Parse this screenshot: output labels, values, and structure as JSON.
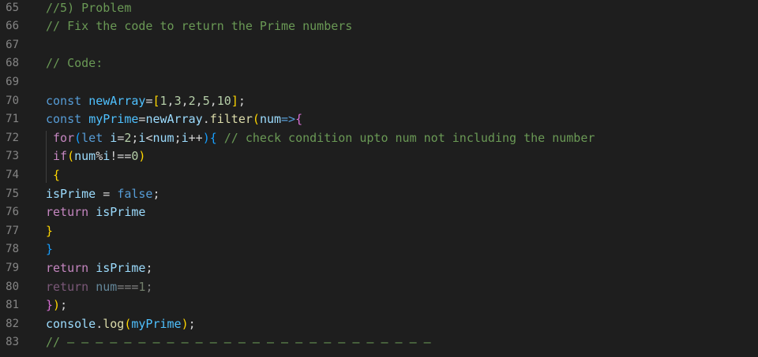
{
  "editor": {
    "colors": {
      "background": "#1e1e1e",
      "line_number": "#858585",
      "comment": "#6a9955",
      "keyword": "#569cd6",
      "control": "#c586c0",
      "variable": "#9cdcfe",
      "constant": "#4fc1ff",
      "function": "#dcdcaa",
      "number": "#b5cea8",
      "plain": "#d4d4d4",
      "bracket1": "#ffd700",
      "bracket2": "#da70d6",
      "bracket3": "#179fff"
    },
    "lines": [
      {
        "number": "65",
        "tokens": [
          {
            "text": "//5) Problem",
            "type": "comment"
          }
        ]
      },
      {
        "number": "66",
        "tokens": [
          {
            "text": "// Fix the code to return the Prime numbers",
            "type": "comment"
          }
        ]
      },
      {
        "number": "67",
        "tokens": []
      },
      {
        "number": "68",
        "tokens": [
          {
            "text": "// Code:",
            "type": "comment"
          }
        ]
      },
      {
        "number": "69",
        "tokens": []
      },
      {
        "number": "70",
        "tokens": [
          {
            "text": "const",
            "type": "keyword"
          },
          {
            "text": " ",
            "type": "plain"
          },
          {
            "text": "newArray",
            "type": "constant"
          },
          {
            "text": "=",
            "type": "plain"
          },
          {
            "text": "[",
            "type": "bracket1"
          },
          {
            "text": "1",
            "type": "num"
          },
          {
            "text": ",",
            "type": "plain"
          },
          {
            "text": "3",
            "type": "num"
          },
          {
            "text": ",",
            "type": "plain"
          },
          {
            "text": "2",
            "type": "num"
          },
          {
            "text": ",",
            "type": "plain"
          },
          {
            "text": "5",
            "type": "num"
          },
          {
            "text": ",",
            "type": "plain"
          },
          {
            "text": "10",
            "type": "num"
          },
          {
            "text": "]",
            "type": "bracket1"
          },
          {
            "text": ";",
            "type": "plain"
          }
        ]
      },
      {
        "number": "71",
        "tokens": [
          {
            "text": "const",
            "type": "keyword"
          },
          {
            "text": " ",
            "type": "plain"
          },
          {
            "text": "myPrime",
            "type": "constant"
          },
          {
            "text": "=",
            "type": "plain"
          },
          {
            "text": "newArray",
            "type": "var"
          },
          {
            "text": ".",
            "type": "plain"
          },
          {
            "text": "filter",
            "type": "func"
          },
          {
            "text": "(",
            "type": "bracket1"
          },
          {
            "text": "num",
            "type": "var"
          },
          {
            "text": "=>",
            "type": "keyword"
          },
          {
            "text": "{",
            "type": "bracket2"
          }
        ]
      },
      {
        "number": "72",
        "tokens": [
          {
            "text": " ",
            "type": "plain"
          },
          {
            "text": "for",
            "type": "control"
          },
          {
            "text": "(",
            "type": "bracket3"
          },
          {
            "text": "let",
            "type": "keyword"
          },
          {
            "text": " ",
            "type": "plain"
          },
          {
            "text": "i",
            "type": "var"
          },
          {
            "text": "=",
            "type": "plain"
          },
          {
            "text": "2",
            "type": "num"
          },
          {
            "text": ";",
            "type": "plain"
          },
          {
            "text": "i",
            "type": "var"
          },
          {
            "text": "<",
            "type": "plain"
          },
          {
            "text": "num",
            "type": "var"
          },
          {
            "text": ";",
            "type": "plain"
          },
          {
            "text": "i",
            "type": "var"
          },
          {
            "text": "++",
            "type": "plain"
          },
          {
            "text": ")",
            "type": "bracket3"
          },
          {
            "text": "{",
            "type": "bracket3"
          },
          {
            "text": " ",
            "type": "plain"
          },
          {
            "text": "// check condition upto num not including the number",
            "type": "comment"
          }
        ]
      },
      {
        "number": "73",
        "tokens": [
          {
            "text": " ",
            "type": "plain"
          },
          {
            "text": "if",
            "type": "control"
          },
          {
            "text": "(",
            "type": "bracket1"
          },
          {
            "text": "num",
            "type": "var"
          },
          {
            "text": "%",
            "type": "plain"
          },
          {
            "text": "i",
            "type": "var"
          },
          {
            "text": "!==",
            "type": "plain"
          },
          {
            "text": "0",
            "type": "num"
          },
          {
            "text": ")",
            "type": "bracket1"
          }
        ]
      },
      {
        "number": "74",
        "tokens": [
          {
            "text": " ",
            "type": "plain"
          },
          {
            "text": "{",
            "type": "bracket1"
          }
        ]
      },
      {
        "number": "75",
        "tokens": [
          {
            "text": "isPrime",
            "type": "var"
          },
          {
            "text": " = ",
            "type": "plain"
          },
          {
            "text": "false",
            "type": "keyword"
          },
          {
            "text": ";",
            "type": "plain"
          }
        ]
      },
      {
        "number": "76",
        "tokens": [
          {
            "text": "return",
            "type": "control"
          },
          {
            "text": " ",
            "type": "plain"
          },
          {
            "text": "isPrime",
            "type": "var"
          }
        ]
      },
      {
        "number": "77",
        "tokens": [
          {
            "text": "}",
            "type": "bracket1"
          }
        ]
      },
      {
        "number": "78",
        "tokens": [
          {
            "text": "}",
            "type": "bracket3"
          }
        ]
      },
      {
        "number": "79",
        "tokens": [
          {
            "text": "return",
            "type": "control"
          },
          {
            "text": " ",
            "type": "plain"
          },
          {
            "text": "isPrime",
            "type": "var"
          },
          {
            "text": ";",
            "type": "plain"
          }
        ]
      },
      {
        "number": "80",
        "faded": true,
        "tokens": [
          {
            "text": "return",
            "type": "control"
          },
          {
            "text": " ",
            "type": "plain"
          },
          {
            "text": "num",
            "type": "var"
          },
          {
            "text": "===",
            "type": "plain"
          },
          {
            "text": "1",
            "type": "num"
          },
          {
            "text": ";",
            "type": "plain"
          }
        ]
      },
      {
        "number": "81",
        "tokens": [
          {
            "text": "}",
            "type": "bracket2"
          },
          {
            "text": ")",
            "type": "bracket1"
          },
          {
            "text": ";",
            "type": "plain"
          }
        ]
      },
      {
        "number": "82",
        "tokens": [
          {
            "text": "console",
            "type": "var"
          },
          {
            "text": ".",
            "type": "plain"
          },
          {
            "text": "log",
            "type": "func"
          },
          {
            "text": "(",
            "type": "bracket1"
          },
          {
            "text": "myPrime",
            "type": "constant"
          },
          {
            "text": ")",
            "type": "bracket1"
          },
          {
            "text": ";",
            "type": "plain"
          }
        ]
      },
      {
        "number": "83",
        "tokens": [
          {
            "text": "// – – – – – – – – – – – – – – – – – – – – – – – – – –",
            "type": "comment"
          }
        ]
      }
    ]
  }
}
